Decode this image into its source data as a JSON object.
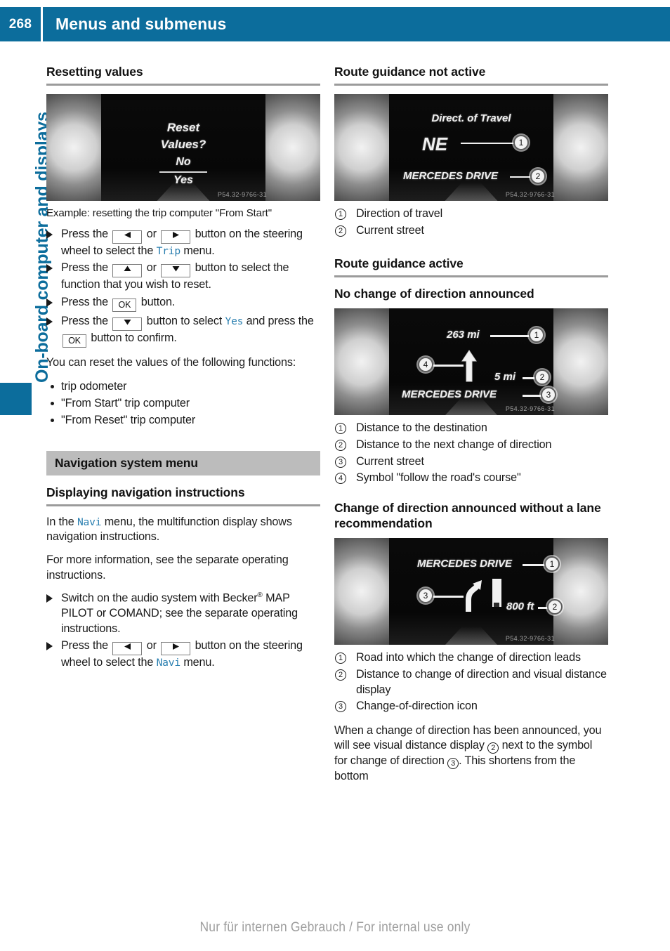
{
  "header": {
    "page_number": "268",
    "title": "Menus and submenus"
  },
  "chapter_rail": {
    "label": "On-board computer and displays"
  },
  "left_column": {
    "heading_resetting": "Resetting values",
    "figure_reset": {
      "line1": "Reset",
      "line2": "Values?",
      "line3": "No",
      "line4": "Yes",
      "code": "P54.32-9766-31"
    },
    "caption": "Example: resetting the trip computer \"From Start\"",
    "steps": [
      {
        "pre": "Press the",
        "key1": "left-arrow",
        "mid": "or",
        "key2": "right-arrow",
        "post": "button on the steering wheel to select the",
        "mono": "Trip",
        "tail": "menu."
      },
      {
        "pre": "Press the",
        "key1": "up-arrow",
        "mid": "or",
        "key2": "down-arrow",
        "post": "button to select the function that you wish to reset.",
        "mono": "",
        "tail": ""
      },
      {
        "pre": "Press the",
        "key1": "OK",
        "mid": "",
        "key2": "",
        "post": "button.",
        "mono": "",
        "tail": ""
      },
      {
        "pre": "Press the",
        "key1": "down-arrow",
        "mid": "",
        "key2": "",
        "post": "button to select",
        "mono": "Yes",
        "tail": "and press the",
        "key3": "OK",
        "tail2": "button to confirm."
      }
    ],
    "reset_intro": "You can reset the values of the following functions:",
    "reset_list": [
      "trip odometer",
      "\"From Start\" trip computer",
      "\"From Reset\" trip computer"
    ],
    "banner_navigation": "Navigation system menu",
    "heading_displaying": "Displaying navigation instructions",
    "para_navi_pre": "In the",
    "para_navi_mono": "Navi",
    "para_navi_post": "menu, the multifunction display shows navigation instructions.",
    "para_more_info": "For more information, see the separate operating instructions.",
    "step_becker_pre": "Switch on the audio system with Becker",
    "step_becker_sup": "®",
    "step_becker_post": "MAP PILOT or COMAND; see the separate operating instructions.",
    "step_navi": {
      "pre": "Press the",
      "key1": "left-arrow",
      "mid": "or",
      "key2": "right-arrow",
      "post": "button on the steering wheel to select the",
      "mono": "Navi",
      "tail": "menu."
    }
  },
  "right_column": {
    "heading_not_active": "Route guidance not active",
    "figure_not_active": {
      "title": "Direct. of Travel",
      "direction": "NE",
      "street": "MERCEDES DRIVE",
      "callout1": "1",
      "callout2": "2",
      "code": "P54.32-9766-31"
    },
    "legend_not_active": [
      {
        "num": "1",
        "text": "Direction of travel"
      },
      {
        "num": "2",
        "text": "Current street"
      }
    ],
    "heading_active": "Route guidance active",
    "heading_no_change": "No change of direction announced",
    "figure_active": {
      "dist_destination": "263 mi",
      "dist_next": "5 mi",
      "street": "MERCEDES DRIVE",
      "callout1": "1",
      "callout2": "2",
      "callout3": "3",
      "callout4": "4",
      "code": "P54.32-9766-31"
    },
    "legend_active": [
      {
        "num": "1",
        "text": "Distance to the destination"
      },
      {
        "num": "2",
        "text": "Distance to the next change of direction"
      },
      {
        "num": "3",
        "text": "Current street"
      },
      {
        "num": "4",
        "text": "Symbol \"follow the road's course\""
      }
    ],
    "heading_change_announced": "Change of direction announced without a lane recommendation",
    "figure_change": {
      "street": "MERCEDES DRIVE",
      "distance": "800 ft",
      "callout1": "1",
      "callout2": "2",
      "callout3": "3",
      "code": "P54.32-9766-31"
    },
    "legend_change": [
      {
        "num": "1",
        "text": "Road into which the change of direction leads"
      },
      {
        "num": "2",
        "text": "Distance to change of direction and visual distance display"
      },
      {
        "num": "3",
        "text": "Change-of-direction icon"
      }
    ],
    "closing_para_1": "When a change of direction has been announced, you will see visual distance display",
    "closing_callout_a": "2",
    "closing_para_2": "next to the symbol for change of direction",
    "closing_callout_b": "3",
    "closing_para_3": ". This shortens from the bottom"
  },
  "footer": {
    "text": "Nur für internen Gebrauch / For internal use only"
  }
}
